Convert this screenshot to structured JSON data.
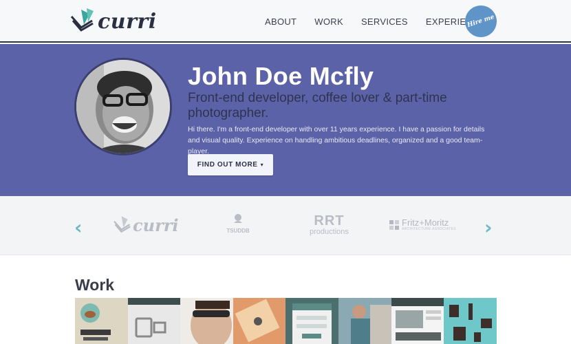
{
  "header": {
    "logo_text": "curri",
    "nav": [
      "ABOUT",
      "WORK",
      "SERVICES",
      "EXPERIENCE"
    ],
    "hire_label": "Hire me"
  },
  "hero": {
    "name": "John Doe Mcfly",
    "tagline": "Front-end developer, coffee lover & part-time photographer.",
    "description": "Hi there. I'm a front-end developer with over 11 years experience. I have a passion for details and visual quality. Experience on handling ambitious deadlines, organized and a good team-player.",
    "button_label": "FIND OUT MORE",
    "bg_color": "#5c62a8"
  },
  "clients": {
    "prev_icon": "chevron-left-icon",
    "next_icon": "chevron-right-icon",
    "logos": {
      "curri": "curri",
      "tsu": "TSUDDB",
      "rrt_line1": "RRT",
      "rrt_line2": "productions",
      "fm_line1": "Fritz+Moritz",
      "fm_line2": "ARCHITECTURE ASSOCIATES"
    }
  },
  "work": {
    "title": "Work",
    "thumbnails": [
      "illegal-burger",
      "web-app",
      "portrait",
      "design-cards",
      "mobile-ui",
      "workshop-photo",
      "website",
      "furniture-pattern"
    ]
  }
}
